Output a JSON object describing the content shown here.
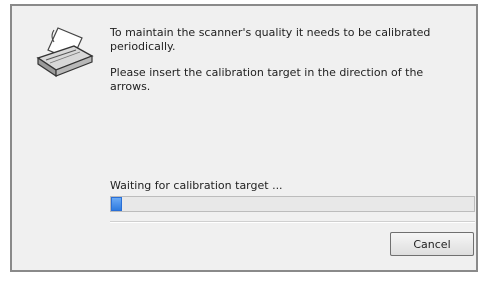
{
  "dialog": {
    "icon": "scanner-icon",
    "message_line1": "To maintain the scanner's quality it needs to be calibrated periodically.",
    "message_line2": "Please insert the calibration target in the direction of the arrows.",
    "status_text": "Waiting for calibration target ...",
    "progress_fraction": 0.03,
    "cancel_label": "Cancel",
    "accent_color": "#2f7be0"
  }
}
